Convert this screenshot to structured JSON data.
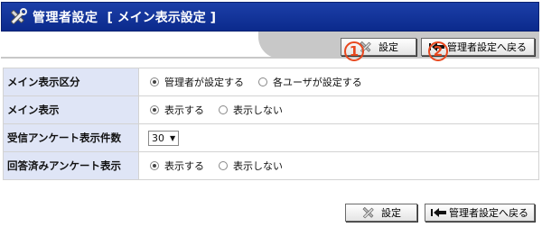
{
  "header": {
    "title": "管理者設定",
    "subtitle": "[ メイン表示設定 ]"
  },
  "toolbar": {
    "settings_label": "設定",
    "back_label": "管理者設定へ戻る",
    "badge_1": "1",
    "badge_2": "2"
  },
  "rows": [
    {
      "label": "メイン表示区分",
      "options": [
        "管理者が設定する",
        "各ユーザが設定する"
      ],
      "selected": 0
    },
    {
      "label": "メイン表示",
      "options": [
        "表示する",
        "表示しない"
      ],
      "selected": 0
    },
    {
      "label": "受信アンケート表示件数",
      "select_value": "30"
    },
    {
      "label": "回答済みアンケート表示",
      "options": [
        "表示する",
        "表示しない"
      ],
      "selected": 0
    }
  ],
  "colors": {
    "header_bg": "#0b2a8c",
    "label_bg": "#dfe5f6",
    "badge": "#e8471e"
  }
}
